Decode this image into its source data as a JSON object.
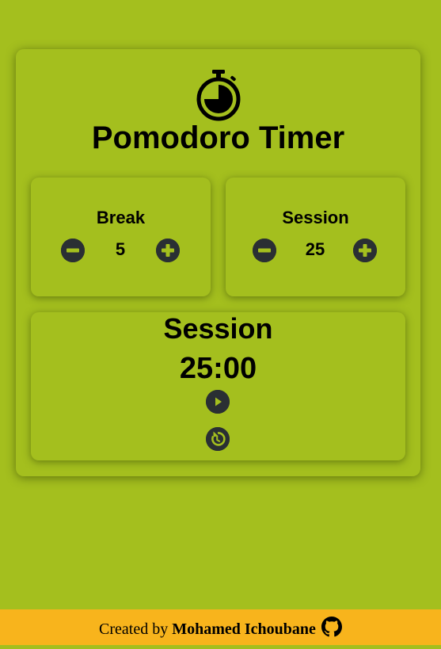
{
  "app": {
    "title": "Pomodoro Timer",
    "icon": "stopwatch-icon"
  },
  "break": {
    "label": "Break",
    "value": "5",
    "decrement_icon": "minus-circle-icon",
    "increment_icon": "plus-circle-icon"
  },
  "session": {
    "label": "Session",
    "value": "25",
    "decrement_icon": "minus-circle-icon",
    "increment_icon": "plus-circle-icon"
  },
  "timer": {
    "label": "Session",
    "time": "25:00",
    "play_icon": "play-circle-icon",
    "reset_icon": "reset-icon"
  },
  "footer": {
    "prefix": "Created by",
    "author": "Mohamed Ichoubane",
    "icon": "github-icon"
  },
  "colors": {
    "background": "#a4bf1e",
    "footer": "#f8b41c",
    "button": "#2a2f33"
  }
}
